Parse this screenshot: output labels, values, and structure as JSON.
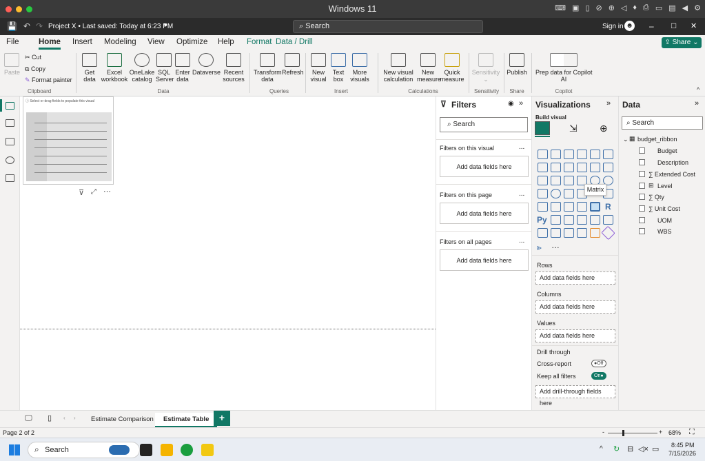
{
  "mac": {
    "window_title": "Windows 11"
  },
  "titlebar": {
    "doc_title": "Project X • Last saved: Today at 6:23 PM",
    "search_label": "Search",
    "sign_in": "Sign in",
    "minimize": "–",
    "restore": "□",
    "close": "✕"
  },
  "menu": {
    "items": [
      "File",
      "Home",
      "Insert",
      "Modeling",
      "View",
      "Optimize",
      "Help",
      "Format",
      "Data / Drill"
    ],
    "share": "Share"
  },
  "ribbon": {
    "clipboard": {
      "paste": "Paste",
      "cut": "Cut",
      "copy": "Copy",
      "format_painter": "Format painter",
      "group": "Clipboard"
    },
    "data": {
      "get_data": "Get\ndata",
      "excel": "Excel\nworkbook",
      "onelake": "OneLake\ncatalog",
      "sql": "SQL\nServer",
      "enter": "Enter\ndata",
      "dataverse": "Dataverse",
      "recent": "Recent\nsources",
      "group": "Data"
    },
    "queries": {
      "transform": "Transform\ndata",
      "refresh": "Refresh",
      "group": "Queries"
    },
    "insert": {
      "new_visual": "New\nvisual",
      "text_box": "Text\nbox",
      "more_visuals": "More\nvisuals",
      "group": "Insert"
    },
    "calculations": {
      "new_visual_calc": "New visual\ncalculation",
      "new_measure": "New\nmeasure",
      "quick_measure": "Quick\nmeasure",
      "group": "Calculations"
    },
    "sensitivity": {
      "label": "Sensitivity",
      "group": "Sensitivity"
    },
    "share": {
      "publish": "Publish",
      "group": "Share"
    },
    "copilot": {
      "prep": "Prep data for Copilot\nAI",
      "group": "Copilot"
    }
  },
  "canvas": {
    "visual_hint": "Select or drag fields to populate this visual"
  },
  "filters": {
    "title": "Filters",
    "search": "Search",
    "on_visual": "Filters on this visual",
    "on_page": "Filters on this page",
    "on_all": "Filters on all pages",
    "add": "Add data fields here",
    "more": "..."
  },
  "viz": {
    "title": "Visualizations",
    "build": "Build visual",
    "tooltip": "Matrix",
    "more": "…",
    "rows": "Rows",
    "columns": "Columns",
    "values": "Values",
    "add": "Add data fields here",
    "drill": "Drill through",
    "cross_report": "Cross-report",
    "cross_state": "Off",
    "keep_filters": "Keep all filters",
    "keep_state": "On",
    "add_drill": "Add drill-through fields here"
  },
  "data": {
    "title": "Data",
    "search": "Search",
    "table": "budget_ribbon",
    "fields": [
      "Budget",
      "Description",
      "∑ Extended Cost",
      "Level",
      "∑ Qty",
      "∑ Unit Cost",
      "UOM",
      "WBS"
    ]
  },
  "tabs": {
    "items": [
      "Estimate Comparison",
      "Estimate Table"
    ],
    "add": "+"
  },
  "status": {
    "page": "Page 2 of 2",
    "zoom": "68%"
  },
  "taskbar": {
    "search": "Search",
    "time": "8:45 PM",
    "date": "7/15/2026"
  },
  "colors": {
    "accent": "#117865",
    "pbi_yellow": "#f2c811",
    "mac_red": "#ff5f57",
    "mac_yellow": "#febc2e",
    "mac_green": "#28c840"
  }
}
